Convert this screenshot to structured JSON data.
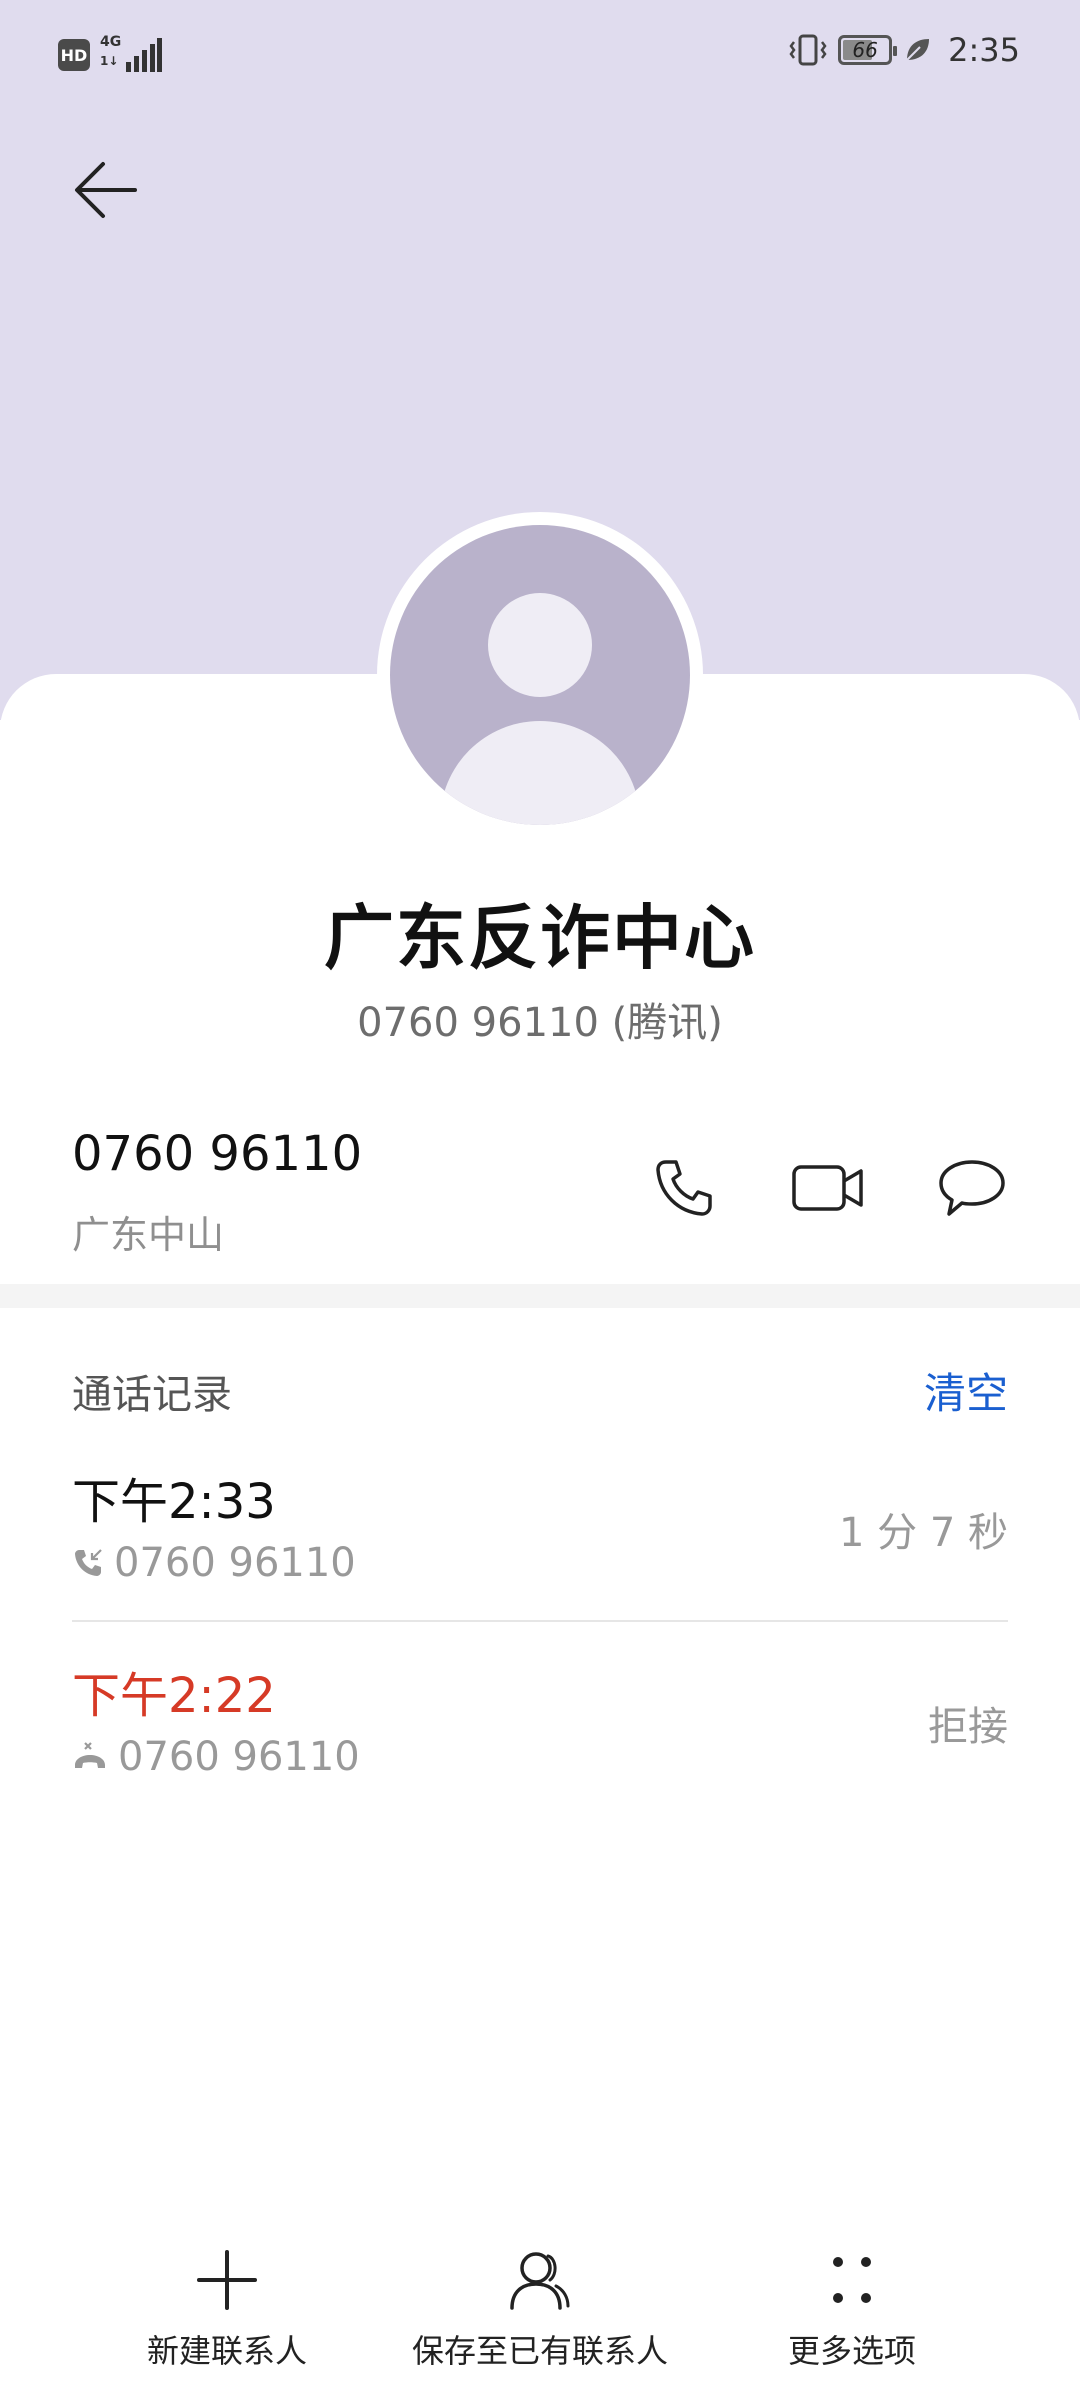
{
  "status_bar": {
    "hd": "HD",
    "network": "4G",
    "network_arrows": "1↓",
    "battery": "66",
    "battery_level": 0.66,
    "time": "2:35"
  },
  "contact": {
    "name": "广东反诈中心",
    "subtitle": "0760 96110 (腾讯)"
  },
  "phone": {
    "number": "0760 96110",
    "location": "广东中山"
  },
  "call_log": {
    "title": "通话记录",
    "clear_label": "清空",
    "entries": [
      {
        "time": "下午2:33",
        "number": "0760 96110",
        "status": "1 分 7 秒",
        "type": "incoming"
      },
      {
        "time": "下午2:22",
        "number": "0760 96110",
        "status": "拒接",
        "type": "rejected"
      }
    ]
  },
  "bottom_bar": {
    "new_contact": "新建联系人",
    "save_existing": "保存至已有联系人",
    "more_options": "更多选项"
  },
  "colors": {
    "header_bg": "#e0dcee",
    "accent_blue": "#1a5fd0",
    "missed_red": "#d63a26"
  }
}
